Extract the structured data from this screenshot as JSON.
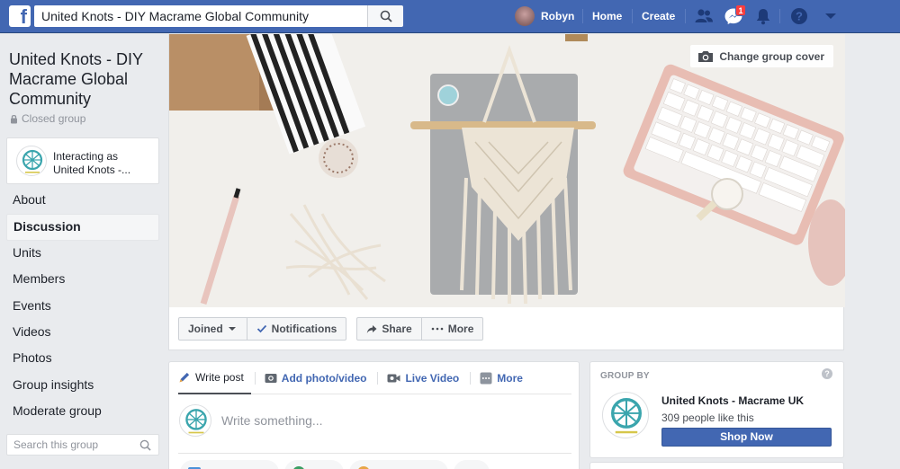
{
  "topbar": {
    "search_value": "United Knots - DIY Macrame Global Community",
    "user_name": "Robyn",
    "home": "Home",
    "create": "Create",
    "messages_badge": "1",
    "icons": [
      "facebook-logo-icon",
      "search-icon",
      "friends-icon",
      "messenger-icon",
      "bell-icon",
      "help-icon",
      "caret-down-icon"
    ]
  },
  "sidebar": {
    "group_title": "United Knots - DIY Macrame Global Community",
    "privacy": "Closed group",
    "interacting_as": "Interacting as United Knots -...",
    "items": [
      {
        "label": "About",
        "active": false
      },
      {
        "label": "Discussion",
        "active": true
      },
      {
        "label": "Units",
        "active": false
      },
      {
        "label": "Members",
        "active": false
      },
      {
        "label": "Events",
        "active": false
      },
      {
        "label": "Videos",
        "active": false
      },
      {
        "label": "Photos",
        "active": false
      },
      {
        "label": "Group insights",
        "active": false
      },
      {
        "label": "Moderate group",
        "active": false
      }
    ],
    "search_placeholder": "Search this group"
  },
  "cover": {
    "change_cover": "Change group cover",
    "buttons": {
      "joined": "Joined",
      "notifications": "Notifications",
      "share": "Share",
      "more": "More"
    }
  },
  "composer": {
    "tabs": {
      "write_post": "Write post",
      "add_photo": "Add photo/video",
      "live_video": "Live Video",
      "more": "More"
    },
    "placeholder": "Write something..."
  },
  "group_by": {
    "header": "GROUP BY",
    "page_name": "United Knots - Macrame UK",
    "likes": "309 people like this",
    "shop_now": "Shop Now"
  },
  "colors": {
    "brand_blue": "#4267b2",
    "badge_red": "#fa3e3e",
    "logo_teal": "#3aa5ad"
  }
}
